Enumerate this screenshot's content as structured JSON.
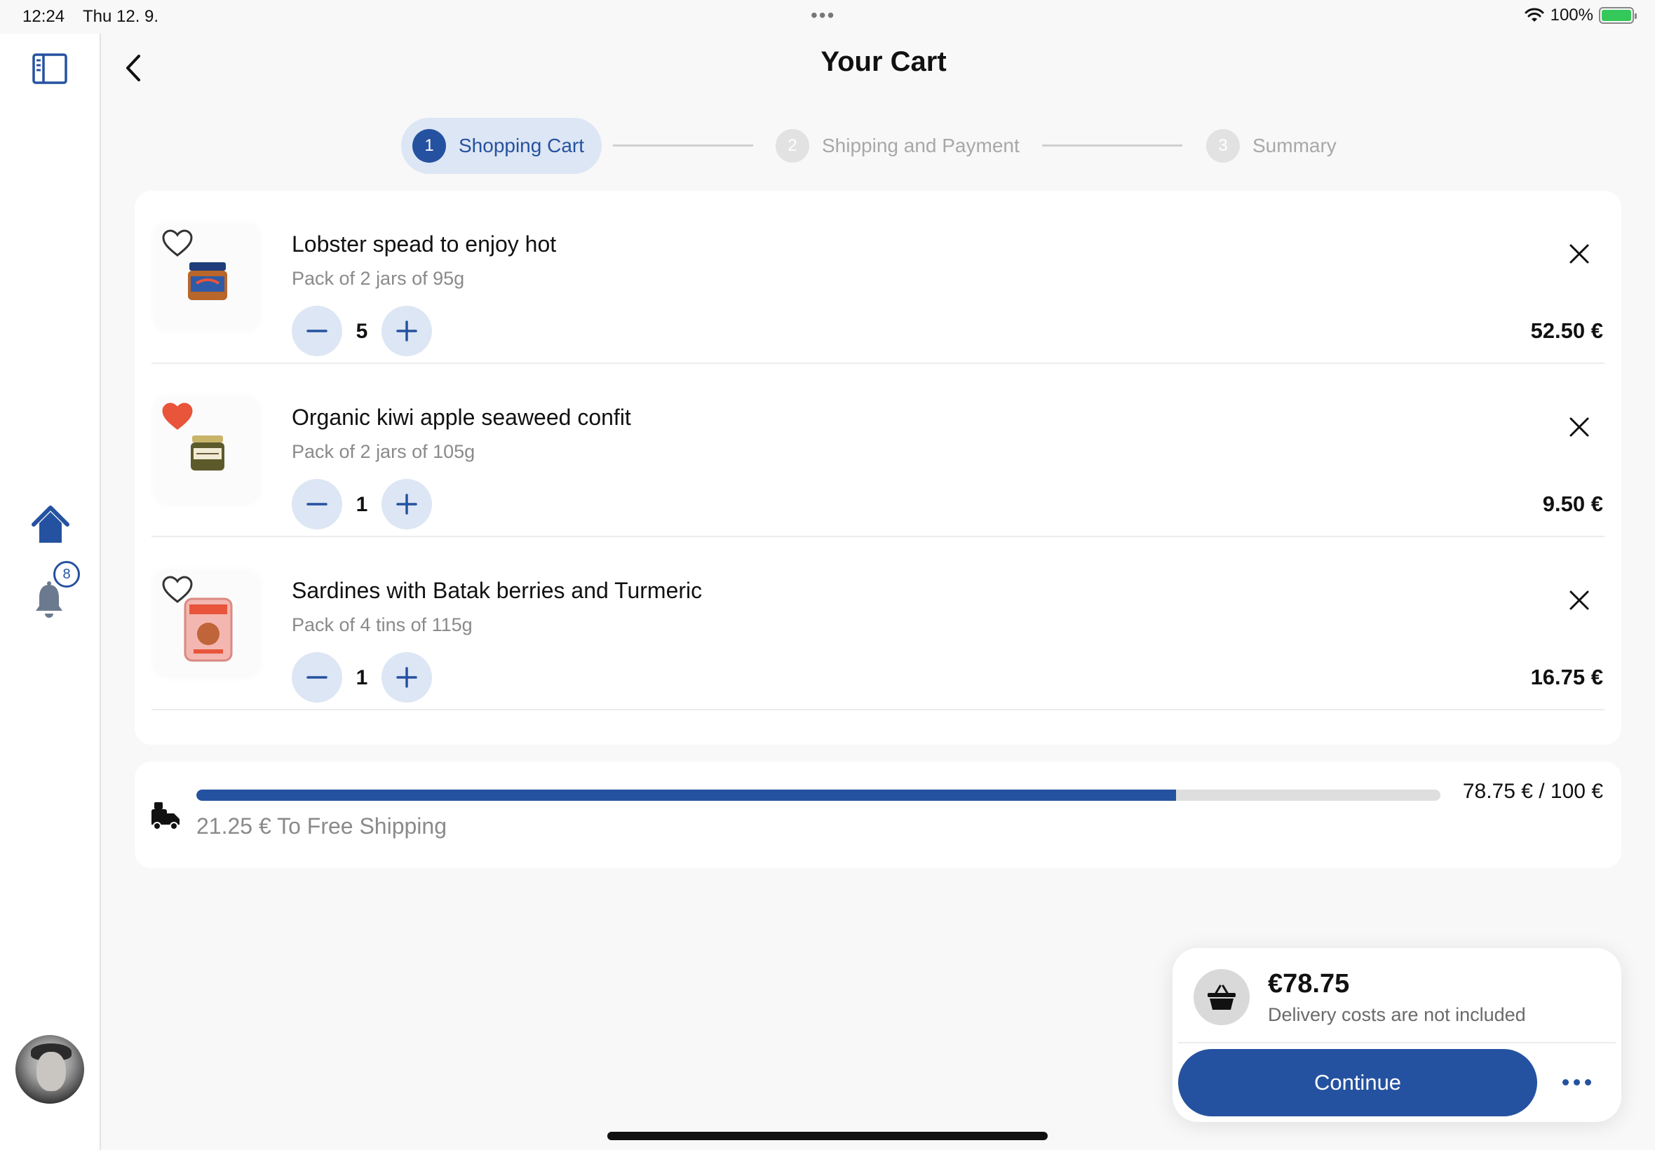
{
  "status_bar": {
    "time": "12:24",
    "date": "Thu 12. 9.",
    "battery": "100%"
  },
  "sidebar": {
    "home_badge": "8"
  },
  "header": {
    "title": "Your Cart"
  },
  "stepper": {
    "steps": [
      {
        "number": "1",
        "label": "Shopping Cart",
        "active": true
      },
      {
        "number": "2",
        "label": "Shipping and Payment",
        "active": false
      },
      {
        "number": "3",
        "label": "Summary",
        "active": false
      }
    ]
  },
  "cart": {
    "items": [
      {
        "name": "Lobster spead to enjoy hot",
        "description": "Pack of 2 jars of 95g",
        "quantity": "5",
        "price": "52.50 €",
        "favorite": false
      },
      {
        "name": "Organic kiwi apple seaweed confit",
        "description": "Pack of 2 jars of 105g",
        "quantity": "1",
        "price": "9.50 €",
        "favorite": true
      },
      {
        "name": "Sardines with Batak berries and Turmeric",
        "description": "Pack of 4 tins of 115g",
        "quantity": "1",
        "price": "16.75 €",
        "favorite": false
      }
    ]
  },
  "shipping": {
    "progress_text": "78.75 € / 100 €",
    "progress_fraction": 0.7875,
    "remaining_text": "21.25 € To Free Shipping"
  },
  "summary": {
    "total": "€78.75",
    "note": "Delivery costs are not included",
    "continue_label": "Continue"
  },
  "colors": {
    "accent": "#2552a0",
    "accent_light": "#dde6f4",
    "favorite": "#e8553a"
  }
}
